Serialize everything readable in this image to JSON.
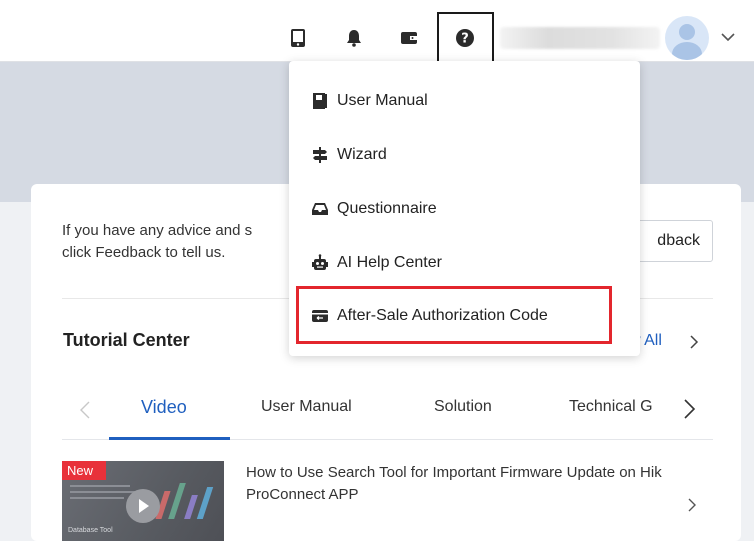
{
  "header": {
    "icons": [
      "tablet-icon",
      "bell-icon",
      "wallet-icon",
      "help-icon"
    ],
    "user_name": "",
    "colors": {
      "accent": "#1f5fbf",
      "highlight": "#e3262d",
      "badge": "#e8313a"
    }
  },
  "help_menu": {
    "items": [
      {
        "label": "User Manual",
        "icon": "book-icon"
      },
      {
        "label": "Wizard",
        "icon": "signpost-icon"
      },
      {
        "label": "Questionnaire",
        "icon": "inbox-icon"
      },
      {
        "label": "AI Help Center",
        "icon": "robot-icon"
      },
      {
        "label": "After-Sale Authorization Code",
        "icon": "card-icon"
      }
    ]
  },
  "feedback": {
    "text": "If you have any advice and suggestions, click Feedback to tell us.",
    "text_line1": "If you have any advice and s",
    "text_line2": "click Feedback to tell us.",
    "button_label": "Feedback",
    "button_visible_label": "dback"
  },
  "tutorial_center": {
    "title": "Tutorial Center",
    "view_all": "View All",
    "view_all_visible": "w All",
    "tabs": [
      {
        "label": "Video",
        "active": true
      },
      {
        "label": "User Manual",
        "active": false
      },
      {
        "label": "Solution",
        "active": false
      },
      {
        "label": "Technical Guide",
        "active": false
      }
    ],
    "visible_tab4": "Technical G",
    "items": [
      {
        "badge": "New",
        "title": "How to Use Search Tool for Important Firmware Update on Hik ProConnect APP",
        "thumb_caption": "Database Tool"
      }
    ]
  }
}
